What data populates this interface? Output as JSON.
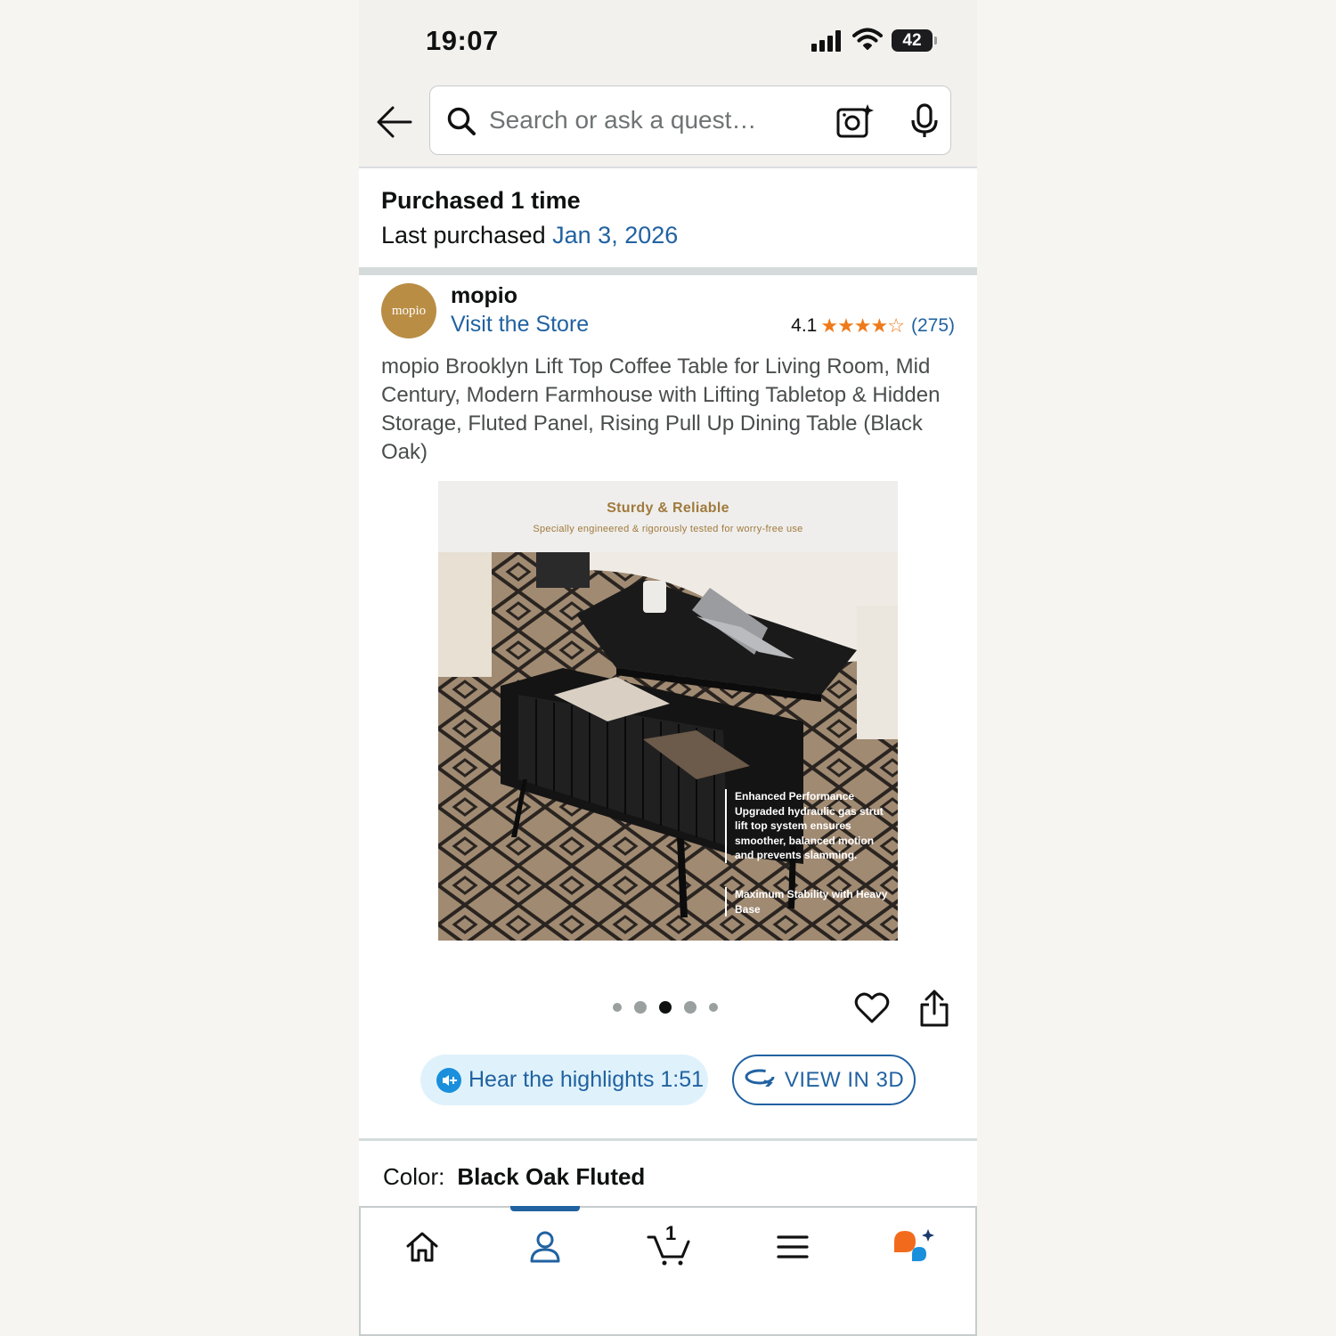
{
  "status_bar": {
    "time": "19:07",
    "battery": "42"
  },
  "search": {
    "placeholder": "Search or ask a quest…"
  },
  "purchase": {
    "heading": "Purchased 1 time",
    "last_label": "Last purchased",
    "last_date": "Jan 3, 2026"
  },
  "store": {
    "logo_text": "mopio",
    "brand": "mopio",
    "visit_label": "Visit the Store",
    "rating": "4.1",
    "rating_fraction": 0.82,
    "review_count": "(275)"
  },
  "product": {
    "title": "mopio Brooklyn Lift Top Coffee Table for Living Room, Mid Century, Modern Farmhouse with Lifting Tabletop & Hidden Storage, Fluted Panel, Rising Pull Up Dining Table (Black Oak)",
    "image": {
      "banner_title": "Sturdy & Reliable",
      "banner_subtitle": "Specially engineered & rigorously tested for worry-free use",
      "feature_title": "Enhanced Performance",
      "feature_text": "Upgraded hydraulic gas strut lift top system ensures smoother, balanced motion and prevents slamming.",
      "feature2_text": "Maximum Stability with Heavy Base"
    },
    "pager": {
      "count": 5,
      "active_index": 2
    }
  },
  "actions": {
    "hear_label": "Hear the highlights 1:51",
    "view3d_label": "VIEW IN 3D"
  },
  "color": {
    "label": "Color:",
    "value": "Black Oak Fluted"
  },
  "bottom_nav": {
    "items": [
      "home-icon",
      "account-icon",
      "cart-icon",
      "menu-icon",
      "rufus-icon"
    ],
    "active": "account-icon",
    "cart_count": "1"
  },
  "colors": {
    "link": "#2162a1",
    "star": "#ef7a1a",
    "accent_orange": "#f26b1d",
    "accent_blue": "#1a8fdc"
  }
}
